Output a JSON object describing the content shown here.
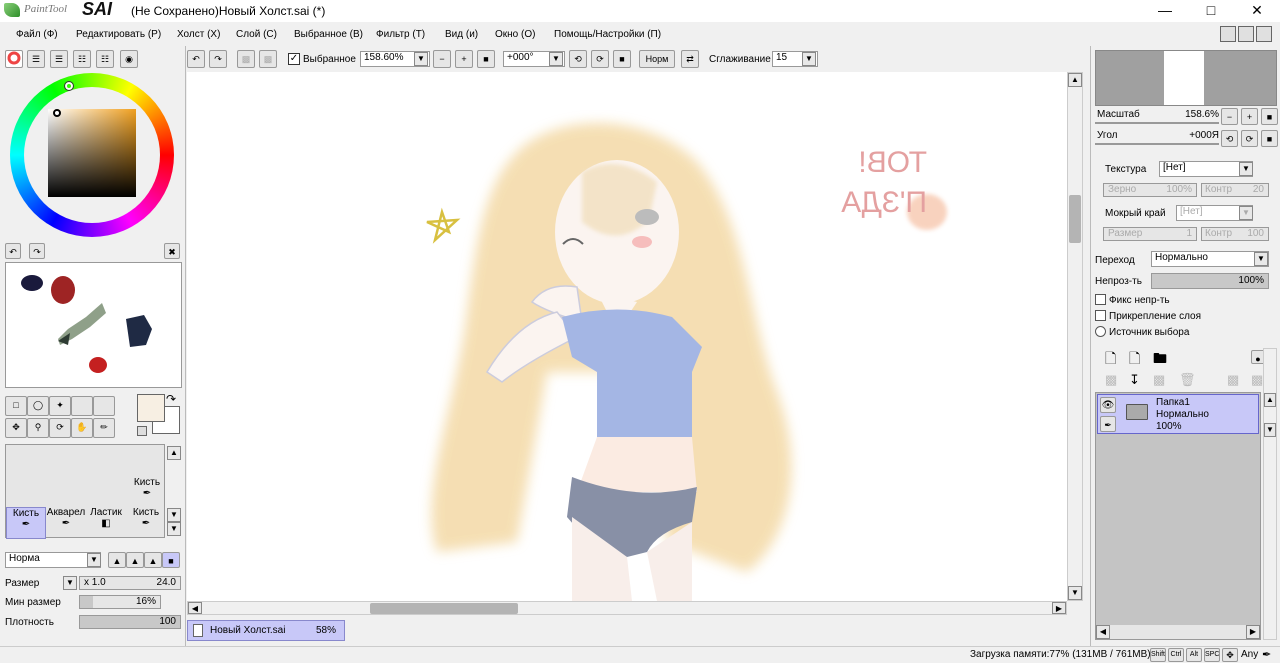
{
  "app": {
    "logo_prefix": "PaintTool",
    "logo_name": "SAI",
    "window_title": "(Не Сохранено)Новый Холст.sai (*)"
  },
  "menu": [
    "Файл (Ф)",
    "Редактировать (Р)",
    "Холст (Х)",
    "Слой (С)",
    "Выбранное (В)",
    "Фильтр (Т)",
    "Вид (и)",
    "Окно (О)",
    "Помощь/Настройки (П)"
  ],
  "toolbar": {
    "selection_label": "Выбранное",
    "zoom_value": "158.60%",
    "angle_value": "+000°",
    "flip_label": "Норм",
    "smoothing_label": "Сглаживание",
    "smoothing_value": "15"
  },
  "navigator": {
    "scale_label": "Масштаб",
    "scale_value": "158.6%",
    "angle_label": "Угол",
    "angle_value": "+000Я"
  },
  "brush_settings": {
    "texture_label": "Текстура",
    "texture_value": "[Нет]",
    "grain_label": "Зерно",
    "grain_value": "100%",
    "contrast_label": "Контр",
    "contrast_value": "20",
    "wet_edge_label": "Мокрый край",
    "wet_edge_value": "[Нет]",
    "size_label": "Размер",
    "size_value": "1",
    "contrast2_label": "Контр",
    "contrast2_value": "100"
  },
  "layer_settings": {
    "blend_label": "Переход",
    "blend_value": "Нормально",
    "opacity_label": "Непроз-ть",
    "opacity_value": "100%",
    "opacity_fraction": 1.0,
    "lock_opacity": "Фикс непр-ть",
    "clip_layer": "Прикрепление слоя",
    "selection_source": "Источник выбора"
  },
  "layers": [
    {
      "name": "Папка1",
      "mode": "Нормально",
      "opacity": "100%"
    }
  ],
  "tools": {
    "brushes": [
      {
        "label": "Кисть"
      },
      {
        "label": "Акварел"
      },
      {
        "label": "Ластик"
      },
      {
        "label": "Кисть"
      }
    ],
    "top_brush": "Кисть"
  },
  "brush_panel": {
    "mode_value": "Норма",
    "size_label": "Размер",
    "size_mult": "x 1.0",
    "size_value": "24.0",
    "min_size_label": "Мин размер",
    "min_size_value": "16%",
    "min_size_fraction": 0.16,
    "density_label": "Плотность",
    "density_value": "100",
    "density_fraction": 1.0
  },
  "document_tab": {
    "name": "Новый Холст.sai",
    "zoom": "58%"
  },
  "statusbar": {
    "memory": "Загрузка памяти:77% (131MB / 761MB)",
    "keys": [
      "Shift",
      "Ctrl",
      "Alt",
      "SPC"
    ],
    "any_label": "Any"
  },
  "canvas_text": {
    "line1": "ТОВ!",
    "line2": "П'ЗДА"
  },
  "colors": {
    "accent": "#c8c8f8",
    "selected": "#b8b8f0",
    "primary_color": "#f7efe3",
    "canvas_bg": "#ffffff"
  }
}
